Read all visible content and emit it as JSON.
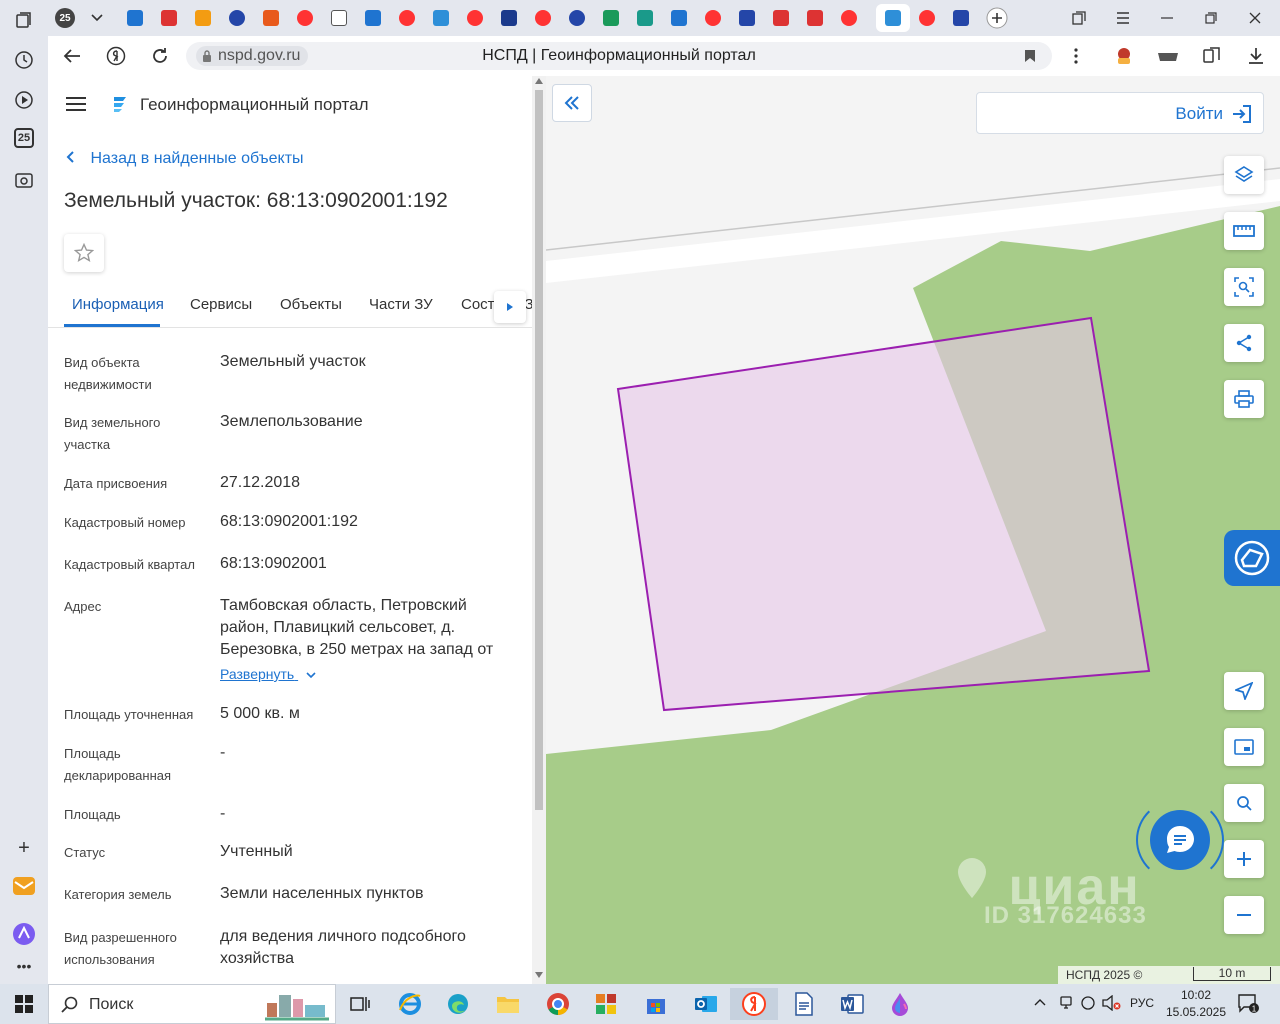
{
  "browser": {
    "tab_title": "НСПД | Геоинформационный портал",
    "url_domain": "nspd.gov.ru",
    "sidebar_badge": "25",
    "tab_badge": "25"
  },
  "panel": {
    "portal_name": "Геоинформационный портал",
    "back_link": "Назад в найденные объекты",
    "title": "Земельный участок: 68:13:0902001:192",
    "tabs": [
      {
        "label": "Информация"
      },
      {
        "label": "Сервисы"
      },
      {
        "label": "Объекты"
      },
      {
        "label": "Части ЗУ"
      },
      {
        "label": "Состав ЕЗ"
      }
    ],
    "expand_label": "Развернуть",
    "properties": [
      {
        "label": "Вид объекта недвижимости",
        "value": "Земельный участок"
      },
      {
        "label": "Вид земельного участка",
        "value": "Землепользование"
      },
      {
        "label": "Дата присвоения",
        "value": "27.12.2018"
      },
      {
        "label": "Кадастровый номер",
        "value": "68:13:0902001:192"
      },
      {
        "label": "Кадастровый квартал",
        "value": "68:13:0902001"
      },
      {
        "label": "Адрес",
        "value": "Тамбовская область, Петровский район, Плавицкий сельсовет, д. Березовка, в 250 метрах на запад от"
      },
      {
        "label": "Площадь уточненная",
        "value": "5 000 кв. м"
      },
      {
        "label": "Площадь декларированная",
        "value": "-"
      },
      {
        "label": "Площадь",
        "value": "-"
      },
      {
        "label": "Статус",
        "value": "Учтенный"
      },
      {
        "label": "Категория земель",
        "value": "Земли населенных пунктов"
      },
      {
        "label": "Вид разрешенного использования",
        "value": "для ведения личного подсобного хозяйства"
      }
    ]
  },
  "map": {
    "login_label": "Войти",
    "watermark_brand": "циан",
    "watermark_id": "ID 317624633",
    "attribution": "НСПД 2025 ©",
    "scale_label": "10 m",
    "colors": {
      "parcel_stroke": "#9b1fb0",
      "parcel_fill": "#e6c6e8",
      "vegetation": "#a7cc89",
      "accent": "#1f74d0"
    }
  },
  "taskbar": {
    "search_label": "Поиск",
    "language": "РУС",
    "time": "10:02",
    "date": "15.05.2025"
  }
}
